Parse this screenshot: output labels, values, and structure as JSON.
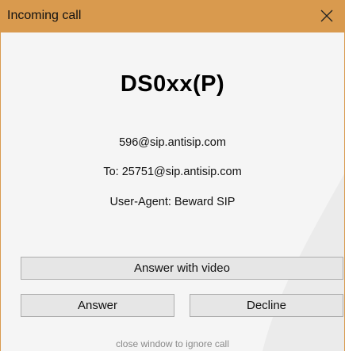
{
  "window": {
    "title": "Incoming call",
    "close_icon": "close-icon"
  },
  "call": {
    "caller_name": "DS0xx(P)",
    "from_address": "596@sip.antisip.com",
    "to_line": "To: 25751@sip.antisip.com",
    "user_agent_line": "User-Agent: Beward SIP"
  },
  "buttons": {
    "answer_with_video": "Answer with video",
    "answer": "Answer",
    "decline": "Decline"
  },
  "hint": "close window to ignore call",
  "colors": {
    "titlebar": "#d99a4e",
    "background": "#f5f5f5",
    "button_face": "#e6e6e6",
    "button_border": "#adadad"
  }
}
